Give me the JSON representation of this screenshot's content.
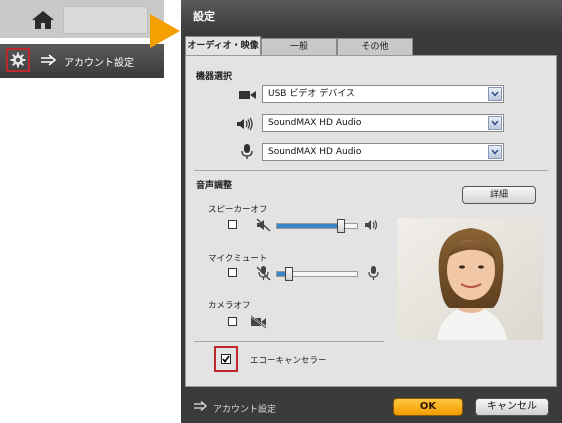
{
  "mini_panel": {
    "home_icon": "home-icon",
    "settings_icon": "gear-icon",
    "arrow_icon": "arrow-right-icon",
    "account_settings_label": "アカウント設定"
  },
  "dialog": {
    "title": "設定",
    "tabs": [
      {
        "label": "オーディオ・映像",
        "active": true
      },
      {
        "label": "一般",
        "active": false
      },
      {
        "label": "その他",
        "active": false
      }
    ],
    "device_section": {
      "label": "機器選択",
      "camera": {
        "icon": "video-camera-icon",
        "value": "USB ビデオ デバイス"
      },
      "speaker": {
        "icon": "speaker-icon",
        "value": "SoundMAX HD Audio"
      },
      "microphone": {
        "icon": "microphone-icon",
        "value": "SoundMAX HD Audio"
      }
    },
    "audio_section": {
      "label": "音声調整",
      "detail_button": "詳細",
      "speaker_off": {
        "label": "スピーカーオフ",
        "checked": false,
        "volume_percent": 80
      },
      "mic_mute": {
        "label": "マイクミュート",
        "checked": false,
        "volume_percent": 15
      },
      "camera_off": {
        "label": "カメラオフ",
        "checked": false
      }
    },
    "echo_canceller": {
      "label": "エコーキャンセラー",
      "checked": true
    },
    "footer": {
      "account_settings_label": "アカウント設定",
      "ok_label": "OK",
      "cancel_label": "キャンセル"
    }
  },
  "colors": {
    "accent_orange": "#f5a000",
    "highlight_red": "#c0272d",
    "slider_blue": "#3a86c8"
  }
}
